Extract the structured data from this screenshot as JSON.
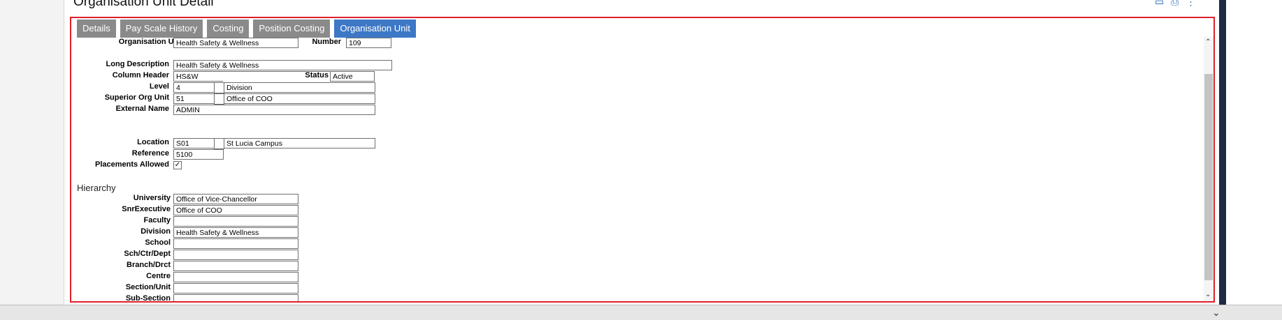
{
  "page": {
    "title": "Organisation Unit Detail",
    "actions": [
      "help-icon",
      "print-icon",
      "more-icon"
    ]
  },
  "tabs": [
    "Details",
    "Pay Scale History",
    "Costing",
    "Position Costing",
    "Organisation Unit"
  ],
  "active_tab": "Organisation Unit",
  "form": {
    "org_unit_label": "Organisation Unit",
    "org_unit_value": "Health Safety & Wellness",
    "number_label": "Number",
    "number_value": "109",
    "long_desc_label": "Long Description",
    "long_desc_value": "Health Safety & Wellness",
    "column_header_label": "Column Header",
    "column_header_value": "HS&W",
    "status_label": "Status",
    "status_value": "Active",
    "level_label": "Level",
    "level_code": "4",
    "level_desc": "Division",
    "superior_label": "Superior Org Unit",
    "superior_code": "51",
    "superior_desc": "Office of COO",
    "external_name_label": "External Name",
    "external_name_value": "ADMIN",
    "location_label": "Location",
    "location_code": "S01",
    "location_desc": "St Lucia Campus",
    "reference_label": "Reference",
    "reference_value": "5100",
    "placements_label": "Placements Allowed",
    "placements_checked": "✓"
  },
  "hierarchy": {
    "title": "Hierarchy",
    "rows": [
      {
        "label": "University",
        "value": "Office of Vice-Chancellor"
      },
      {
        "label": "SnrExecutive",
        "value": "Office of COO"
      },
      {
        "label": "Faculty",
        "value": ""
      },
      {
        "label": "Division",
        "value": "Health Safety & Wellness"
      },
      {
        "label": "School",
        "value": ""
      },
      {
        "label": "Sch/Ctr/Dept",
        "value": ""
      },
      {
        "label": "Branch/Drct",
        "value": ""
      },
      {
        "label": "Centre",
        "value": ""
      },
      {
        "label": "Section/Unit",
        "value": ""
      },
      {
        "label": "Sub-Section",
        "value": ""
      }
    ]
  }
}
